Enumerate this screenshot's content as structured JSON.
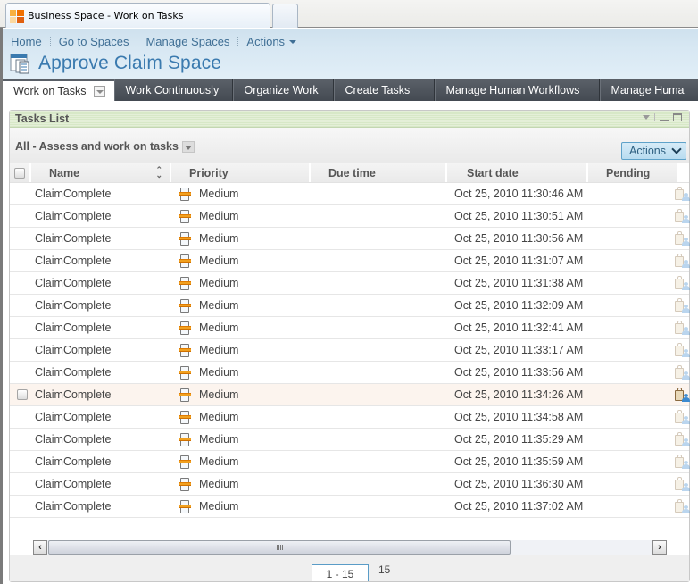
{
  "browser": {
    "tab_title": "Business Space - Work on Tasks"
  },
  "topnav": {
    "links": [
      "Home",
      "Go to Spaces",
      "Manage Spaces",
      "Actions"
    ]
  },
  "space": {
    "title": "Approve Claim Space"
  },
  "page_tabs": [
    {
      "label": "Work on Tasks",
      "active": true
    },
    {
      "label": "Work Continuously",
      "active": false
    },
    {
      "label": "Organize Work",
      "active": false
    },
    {
      "label": "Create Tasks",
      "active": false
    },
    {
      "label": "Manage Human Workflows",
      "active": false
    },
    {
      "label": "Manage Huma",
      "active": false
    }
  ],
  "widget": {
    "title": "Tasks List",
    "filter_label": "All - Assess and work on tasks",
    "actions_label": "Actions",
    "columns": [
      "Name",
      "Priority",
      "Due time",
      "Start date",
      "Pending"
    ],
    "rows": [
      {
        "name": "ClaimComplete",
        "priority": "Medium",
        "due": "",
        "start": "Oct 25, 2010 11:30:46 AM"
      },
      {
        "name": "ClaimComplete",
        "priority": "Medium",
        "due": "",
        "start": "Oct 25, 2010 11:30:51 AM"
      },
      {
        "name": "ClaimComplete",
        "priority": "Medium",
        "due": "",
        "start": "Oct 25, 2010 11:30:56 AM"
      },
      {
        "name": "ClaimComplete",
        "priority": "Medium",
        "due": "",
        "start": "Oct 25, 2010 11:31:07 AM"
      },
      {
        "name": "ClaimComplete",
        "priority": "Medium",
        "due": "",
        "start": "Oct 25, 2010 11:31:38 AM"
      },
      {
        "name": "ClaimComplete",
        "priority": "Medium",
        "due": "",
        "start": "Oct 25, 2010 11:32:09 AM"
      },
      {
        "name": "ClaimComplete",
        "priority": "Medium",
        "due": "",
        "start": "Oct 25, 2010 11:32:41 AM"
      },
      {
        "name": "ClaimComplete",
        "priority": "Medium",
        "due": "",
        "start": "Oct 25, 2010 11:33:17 AM"
      },
      {
        "name": "ClaimComplete",
        "priority": "Medium",
        "due": "",
        "start": "Oct 25, 2010 11:33:56 AM"
      },
      {
        "name": "ClaimComplete",
        "priority": "Medium",
        "due": "",
        "start": "Oct 25, 2010 11:34:26 AM",
        "hover": true
      },
      {
        "name": "ClaimComplete",
        "priority": "Medium",
        "due": "",
        "start": "Oct 25, 2010 11:34:58 AM"
      },
      {
        "name": "ClaimComplete",
        "priority": "Medium",
        "due": "",
        "start": "Oct 25, 2010 11:35:29 AM"
      },
      {
        "name": "ClaimComplete",
        "priority": "Medium",
        "due": "",
        "start": "Oct 25, 2010 11:35:59 AM"
      },
      {
        "name": "ClaimComplete",
        "priority": "Medium",
        "due": "",
        "start": "Oct 25, 2010 11:36:30 AM"
      },
      {
        "name": "ClaimComplete",
        "priority": "Medium",
        "due": "",
        "start": "Oct 25, 2010 11:37:02 AM"
      }
    ],
    "pager": {
      "range": "1 - 15",
      "total": "15"
    }
  },
  "colors": {
    "accent": "#3a7aaf",
    "nav_link": "#3f6f95",
    "tab_bar": "#4c525a",
    "widget_header": "#dcebcc",
    "hover_row": "#fcf4ee",
    "priority_medium": "#f0a020"
  }
}
